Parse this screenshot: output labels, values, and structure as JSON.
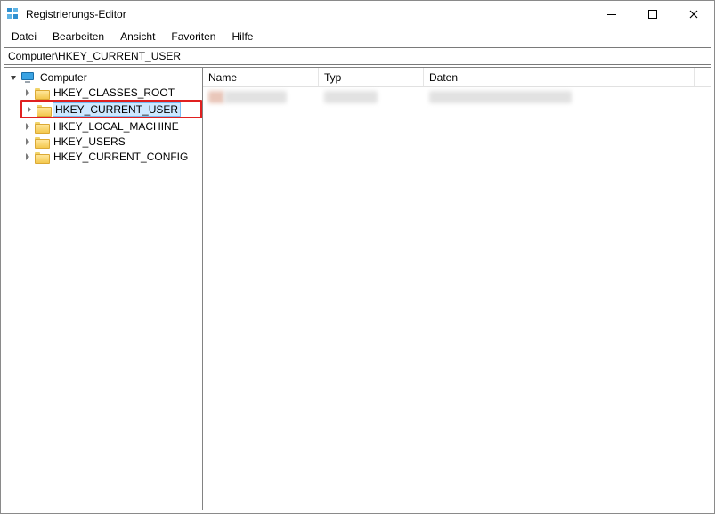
{
  "window": {
    "title": "Registrierungs-Editor"
  },
  "menubar": {
    "items": [
      {
        "label": "Datei"
      },
      {
        "label": "Bearbeiten"
      },
      {
        "label": "Ansicht"
      },
      {
        "label": "Favoriten"
      },
      {
        "label": "Hilfe"
      }
    ]
  },
  "addressbar": {
    "path": "Computer\\HKEY_CURRENT_USER"
  },
  "tree": {
    "root": {
      "label": "Computer",
      "expanded": true
    },
    "children": [
      {
        "label": "HKEY_CLASSES_ROOT",
        "selected": false,
        "highlighted": false
      },
      {
        "label": "HKEY_CURRENT_USER",
        "selected": true,
        "highlighted": true
      },
      {
        "label": "HKEY_LOCAL_MACHINE",
        "selected": false,
        "highlighted": false
      },
      {
        "label": "HKEY_USERS",
        "selected": false,
        "highlighted": false
      },
      {
        "label": "HKEY_CURRENT_CONFIG",
        "selected": false,
        "highlighted": false
      }
    ]
  },
  "list": {
    "columns": {
      "name": "Name",
      "typ": "Typ",
      "daten": "Daten"
    }
  }
}
